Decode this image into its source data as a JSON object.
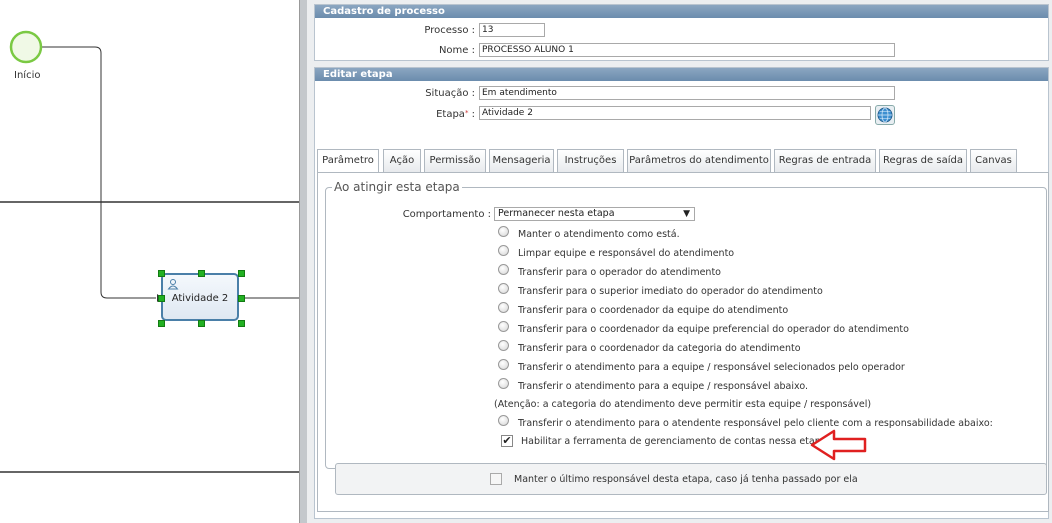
{
  "diagram": {
    "start_label": "Início",
    "task_label": "Atividade 2",
    "start_color": "#7ac943",
    "task_border_color": "#4a7fa8",
    "handle_color": "#22b022"
  },
  "cadastro": {
    "header": "Cadastro de processo",
    "processo_label": "Processo :",
    "processo_value": "13",
    "nome_label": "Nome :",
    "nome_value": "PROCESSO ALUNO 1"
  },
  "editar": {
    "header": "Editar etapa",
    "situacao_label": "Situação :",
    "situacao_value": "Em atendimento",
    "etapa_label": "Etapa",
    "etapa_required": "*",
    "etapa_colon": ":",
    "etapa_value": "Atividade 2",
    "globe_icon": "globe-icon"
  },
  "tabs": [
    {
      "label": "Parâmetro",
      "active": true
    },
    {
      "label": "Ação"
    },
    {
      "label": "Permissão"
    },
    {
      "label": "Mensageria"
    },
    {
      "label": "Instruções"
    },
    {
      "label": "Parâmetros do atendimento"
    },
    {
      "label": "Regras de entrada"
    },
    {
      "label": "Regras de saída"
    },
    {
      "label": "Canvas"
    }
  ],
  "parametro": {
    "legend": "Ao atingir esta etapa",
    "comportamento_label": "Comportamento :",
    "comportamento_value": "Permanecer nesta etapa",
    "options": [
      "Manter o atendimento como está.",
      "Limpar equipe e responsável do atendimento",
      "Transferir para o operador do atendimento",
      "Transferir para o superior imediato do operador do atendimento",
      "Transferir para o coordenador da equipe do atendimento",
      "Transferir para o coordenador da equipe preferencial do operador do atendimento",
      "Transferir para o coordenador da categoria do atendimento",
      "Transferir o atendimento para a equipe / responsável selecionados pelo operador",
      "Transferir o atendimento para a equipe / responsável abaixo."
    ],
    "note": "(Atenção: a categoria do atendimento deve permitir esta equipe / responsável)",
    "option_last": "Transferir o atendimento para o atendente responsável pelo cliente com a responsabilidade abaixo:",
    "checkbox_ferramenta_label": "Habilitar a ferramenta de gerenciamento de contas nessa etapa",
    "checkbox_ferramenta_checked": true,
    "checkbox_manter_label": "Manter o último responsável desta etapa, caso já tenha passado por ela",
    "checkbox_manter_checked": false,
    "arrow_color": "#e02020"
  }
}
